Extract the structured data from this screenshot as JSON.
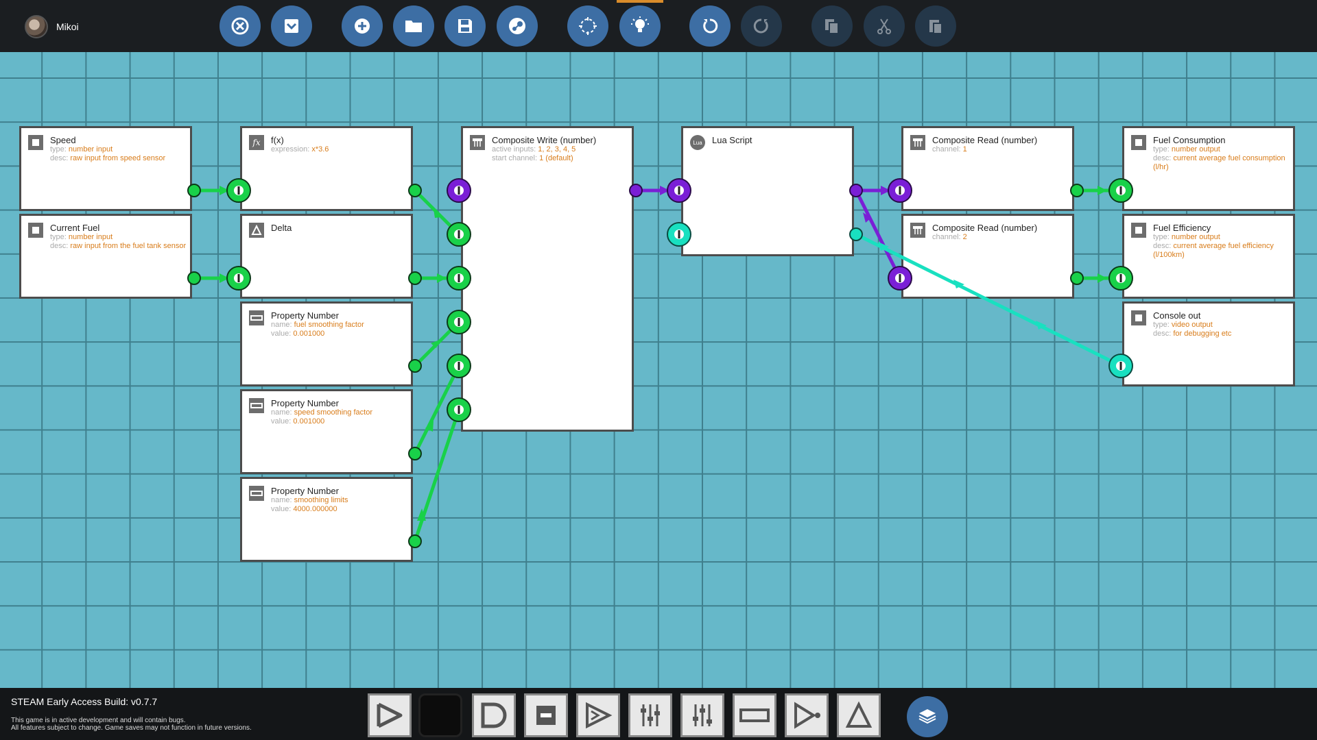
{
  "user": {
    "name": "Mikoi"
  },
  "toolbar": {
    "close": "close-icon",
    "dropdown": "chevron-down-icon",
    "add": "plus-icon",
    "open": "folder-icon",
    "save": "save-icon",
    "steam": "steam-icon",
    "select": "select-icon",
    "hint": "lightbulb-icon",
    "undo": "undo-icon",
    "redo": "redo-icon",
    "copy": "copy-icon",
    "cut": "cut-icon",
    "paste": "paste-icon"
  },
  "nodes": {
    "speed": {
      "title": "Speed",
      "k1": "type:",
      "v1": "number input",
      "k2": "desc:",
      "v2": "raw input from speed sensor"
    },
    "fuel": {
      "title": "Current Fuel",
      "k1": "type:",
      "v1": "number input",
      "k2": "desc:",
      "v2": "raw input from the fuel tank sensor"
    },
    "fx": {
      "title": "f(x)",
      "k1": "expression:",
      "v1": "x*3.6"
    },
    "delta": {
      "title": "Delta"
    },
    "prop1": {
      "title": "Property Number",
      "k1": "name:",
      "v1": "fuel smoothing factor",
      "k2": "value:",
      "v2": "0.001000"
    },
    "prop2": {
      "title": "Property Number",
      "k1": "name:",
      "v1": "speed smoothing factor",
      "k2": "value:",
      "v2": "0.001000"
    },
    "prop3": {
      "title": "Property Number",
      "k1": "name:",
      "v1": "smoothing limits",
      "k2": "value:",
      "v2": "4000.000000"
    },
    "cwrite": {
      "title": "Composite Write (number)",
      "k1": "active inputs:",
      "v1": "1, 2, 3, 4, 5",
      "k2": "start channel:",
      "v2": "1 (default)"
    },
    "lua": {
      "title": "Lua Script"
    },
    "cread1": {
      "title": "Composite Read (number)",
      "k1": "channel:",
      "v1": "1"
    },
    "cread2": {
      "title": "Composite Read (number)",
      "k1": "channel:",
      "v1": "2"
    },
    "fcons": {
      "title": "Fuel Consumption",
      "k1": "type:",
      "v1": "number output",
      "k2": "desc:",
      "v2": "current average fuel consumption (l/hr)"
    },
    "feff": {
      "title": "Fuel Efficiency",
      "k1": "type:",
      "v1": "number output",
      "k2": "desc:",
      "v2": "current average fuel efficiency (l/100km)"
    },
    "console": {
      "title": "Console out",
      "k1": "type:",
      "v1": "video output",
      "k2": "desc:",
      "v2": "for debugging etc"
    }
  },
  "colors": {
    "grid_bg": "#66b8c9",
    "number_wire": "#19d149",
    "composite_wire": "#7a1fd6",
    "video_wire": "#19e0c0",
    "accent": "#3d6ea4"
  },
  "footer": {
    "build": "STEAM Early Access Build: v0.7.7",
    "note1": "This game is in active development and will contain bugs.",
    "note2": "All features subject to change. Game saves may not function in future versions."
  },
  "palette": [
    "arrow-icon",
    "blank-icon",
    "and-gate-icon",
    "minus-icon",
    "split-icon",
    "sliders-icon",
    "sliders2-icon",
    "property-icon",
    "play-node-icon",
    "delta-icon"
  ],
  "grid_button": "grid-icon"
}
